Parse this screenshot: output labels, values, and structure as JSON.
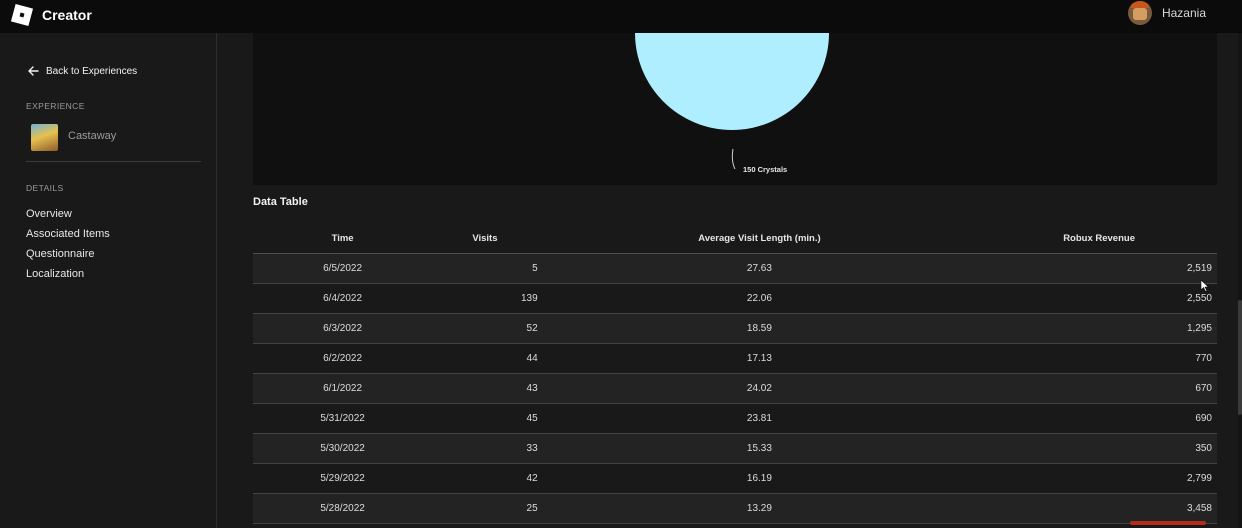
{
  "app": {
    "name": "Creator",
    "logo_icon": "roblox-logo-icon"
  },
  "user": {
    "name": "Hazania",
    "avatar_icon": "user-avatar-icon"
  },
  "sidebar": {
    "back_label": "Back to Experiences",
    "experience_section": "EXPERIENCE",
    "experience_name": "Castaway",
    "details_section": "DETAILS",
    "items": [
      {
        "label": "Overview"
      },
      {
        "label": "Associated Items"
      },
      {
        "label": "Questionnaire"
      },
      {
        "label": "Localization"
      }
    ]
  },
  "chart": {
    "slice_label": "150 Crystals",
    "slice_color": "#aeeeff"
  },
  "table": {
    "title": "Data Table",
    "headers": {
      "time": "Time",
      "visits": "Visits",
      "avg": "Average Visit Length (min.)",
      "revenue": "Robux Revenue"
    },
    "rows": [
      {
        "time": "6/5/2022",
        "visits": "5",
        "avg": "27.63",
        "revenue": "2,519"
      },
      {
        "time": "6/4/2022",
        "visits": "139",
        "avg": "22.06",
        "revenue": "2,550"
      },
      {
        "time": "6/3/2022",
        "visits": "52",
        "avg": "18.59",
        "revenue": "1,295"
      },
      {
        "time": "6/2/2022",
        "visits": "44",
        "avg": "17.13",
        "revenue": "770"
      },
      {
        "time": "6/1/2022",
        "visits": "43",
        "avg": "24.02",
        "revenue": "670"
      },
      {
        "time": "5/31/2022",
        "visits": "45",
        "avg": "23.81",
        "revenue": "690"
      },
      {
        "time": "5/30/2022",
        "visits": "33",
        "avg": "15.33",
        "revenue": "350"
      },
      {
        "time": "5/29/2022",
        "visits": "42",
        "avg": "16.19",
        "revenue": "2,799"
      },
      {
        "time": "5/28/2022",
        "visits": "25",
        "avg": "13.29",
        "revenue": "3,458"
      }
    ]
  }
}
